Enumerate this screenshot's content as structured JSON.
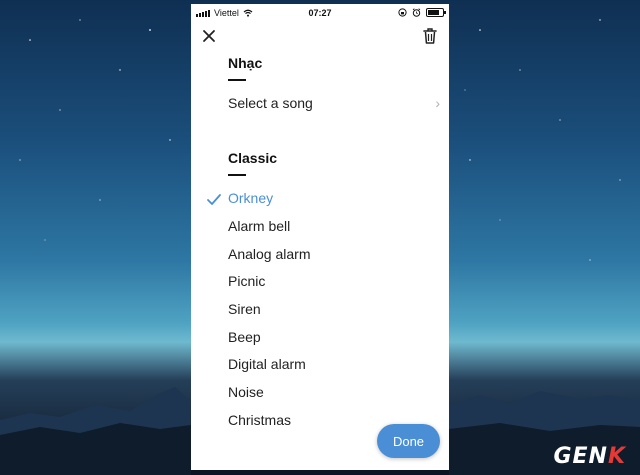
{
  "status_bar": {
    "carrier": "Viettel",
    "time": "07:27",
    "icons": [
      "signal-icon",
      "wifi-icon",
      "lock-rotation-icon",
      "alarm-icon",
      "battery-icon"
    ]
  },
  "header": {
    "close_icon": "close-icon",
    "delete_icon": "trash-icon"
  },
  "music_section": {
    "title": "Nhạc",
    "select_song_label": "Select a song",
    "chevron_icon": "chevron-right-icon"
  },
  "classic_section": {
    "title": "Classic",
    "selected": "Orkney",
    "tones": [
      "Orkney",
      "Alarm bell",
      "Analog alarm",
      "Picnic",
      "Siren",
      "Beep",
      "Digital alarm",
      "Noise",
      "Christmas"
    ]
  },
  "done_label": "Done",
  "watermark": {
    "prefix": "GEN",
    "suffix": "K"
  },
  "colors": {
    "accent": "#4a8fd6",
    "text": "#222222",
    "watermark_accent": "#e53935"
  }
}
